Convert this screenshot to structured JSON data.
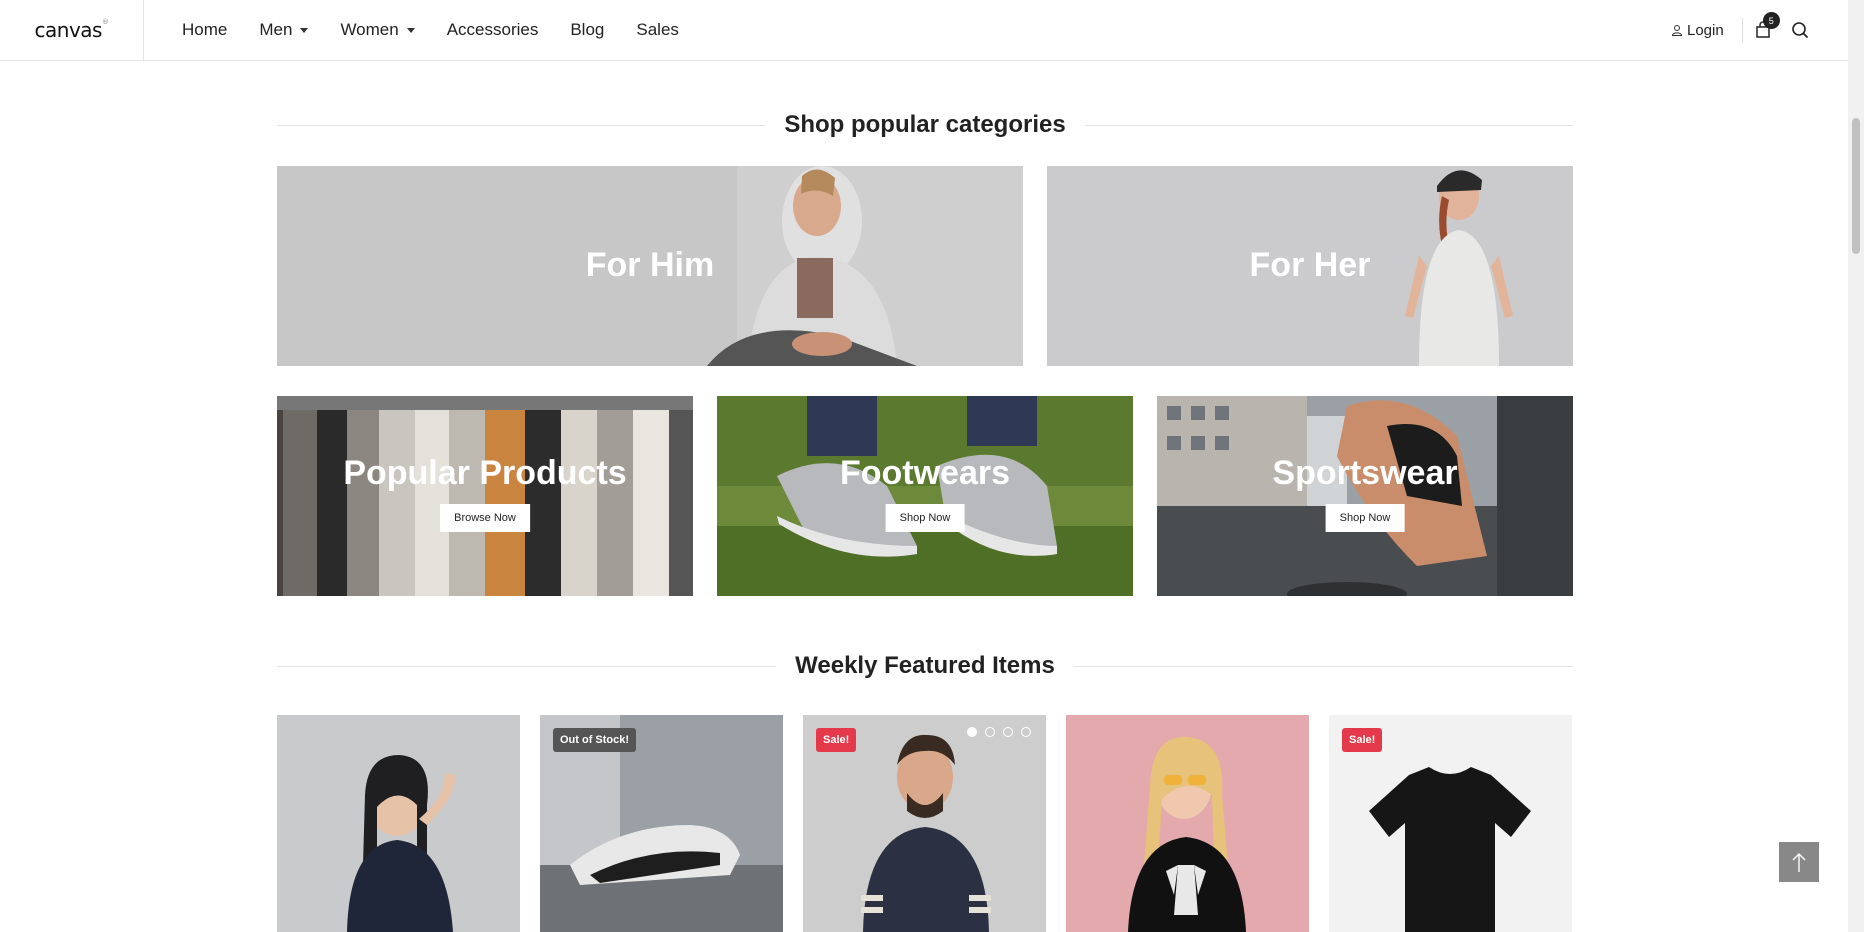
{
  "header": {
    "logo": "canvas",
    "logo_mark": "®",
    "nav": [
      {
        "label": "Home",
        "dropdown": false
      },
      {
        "label": "Men",
        "dropdown": true
      },
      {
        "label": "Women",
        "dropdown": true
      },
      {
        "label": "Accessories",
        "dropdown": false
      },
      {
        "label": "Blog",
        "dropdown": false
      },
      {
        "label": "Sales",
        "dropdown": false
      }
    ],
    "login_label": "Login",
    "cart_count": "5",
    "icons": [
      "user-icon",
      "cart-icon",
      "search-icon"
    ]
  },
  "categories_section": {
    "title": "Shop popular categories",
    "featured": [
      {
        "label": "For Him"
      },
      {
        "label": "For Her"
      }
    ],
    "tiles": [
      {
        "label": "Popular Products",
        "button": "Browse Now"
      },
      {
        "label": "Footwears",
        "button": "Shop Now"
      },
      {
        "label": "Sportswear",
        "button": "Shop Now"
      }
    ]
  },
  "featured_section": {
    "title": "Weekly Featured Items",
    "products": [
      {
        "badge": null
      },
      {
        "badge": "Out of Stock!"
      },
      {
        "badge": "Sale!",
        "carousel_dots": 4,
        "active_dot": 1
      },
      {
        "badge": null
      },
      {
        "badge": "Sale!"
      }
    ]
  },
  "colors": {
    "sale_badge": "#e4394a",
    "out_of_stock_badge": "#555555",
    "back_to_top": "#888888"
  }
}
